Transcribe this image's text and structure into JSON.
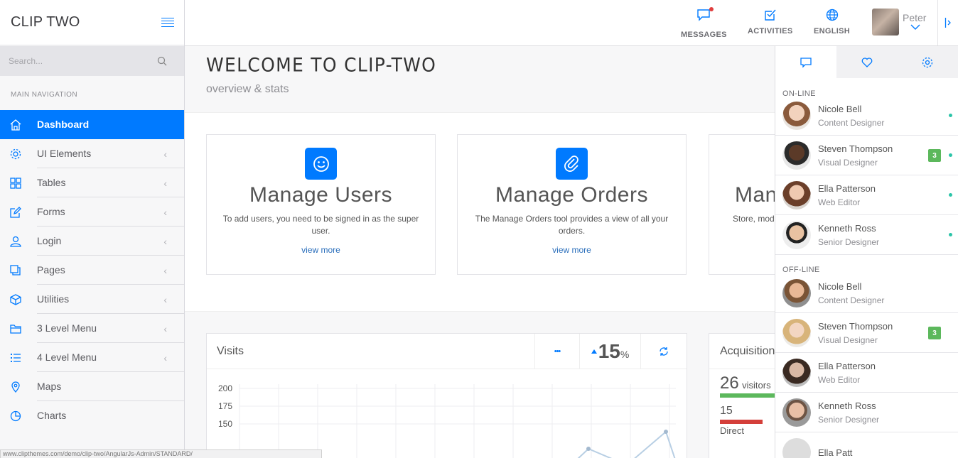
{
  "brand": "CLIP TWO",
  "search": {
    "placeholder": "Search..."
  },
  "sidebar": {
    "title": "MAIN NAVIGATION",
    "items": [
      {
        "label": "Dashboard"
      },
      {
        "label": "UI Elements"
      },
      {
        "label": "Tables"
      },
      {
        "label": "Forms"
      },
      {
        "label": "Login"
      },
      {
        "label": "Pages"
      },
      {
        "label": "Utilities"
      },
      {
        "label": "3 Level Menu"
      },
      {
        "label": "4 Level Menu"
      },
      {
        "label": "Maps"
      },
      {
        "label": "Charts"
      }
    ]
  },
  "topbar": {
    "messages": "MESSAGES",
    "activities": "ACTIVITIES",
    "english": "ENGLISH",
    "user": "Peter"
  },
  "welcome": {
    "title": "WELCOME TO CLIP-TWO",
    "subtitle": "overview & stats"
  },
  "cards": [
    {
      "title": "Manage Users",
      "text": "To add users, you need to be signed in as the super user.",
      "link": "view more"
    },
    {
      "title": "Manage Orders",
      "text": "The Manage Orders tool provides a view of all your orders.",
      "link": "view more"
    },
    {
      "title": "Man",
      "text": "Store, mod",
      "link": ""
    }
  ],
  "visits": {
    "title": "Visits",
    "more": "•••",
    "percent": "15",
    "percent_sign": "%"
  },
  "chart_data": {
    "type": "line",
    "yticks": [
      "200",
      "175",
      "150"
    ],
    "ylim": [
      150,
      200
    ]
  },
  "acquisition": {
    "title": "Acquisition",
    "visitors_num": "26",
    "visitors_label": "visitors",
    "direct_num": "15",
    "direct_label": "Direct"
  },
  "rightpanel": {
    "online_title": "ON-LINE",
    "offline_title": "OFF-LINE",
    "online": [
      {
        "name": "Nicole Bell",
        "role": "Content Designer",
        "badge": ""
      },
      {
        "name": "Steven Thompson",
        "role": "Visual Designer",
        "badge": "3"
      },
      {
        "name": "Ella Patterson",
        "role": "Web Editor",
        "badge": ""
      },
      {
        "name": "Kenneth Ross",
        "role": "Senior Designer",
        "badge": ""
      }
    ],
    "offline": [
      {
        "name": "Nicole Bell",
        "role": "Content Designer",
        "badge": ""
      },
      {
        "name": "Steven Thompson",
        "role": "Visual Designer",
        "badge": "3"
      },
      {
        "name": "Ella Patterson",
        "role": "Web Editor",
        "badge": ""
      },
      {
        "name": "Kenneth Ross",
        "role": "Senior Designer",
        "badge": ""
      }
    ],
    "partial_name": "Ella Patt"
  },
  "statusbar": "www.clipthemes.com/demo/clip-two/AngularJs-Admin/STANDARD/",
  "colors": {
    "accent": "#007aff",
    "online": "#2bc4a8",
    "badge": "#5cb85c",
    "visitors_bar": "#5cb85c",
    "direct_bar": "#d43f3a"
  }
}
